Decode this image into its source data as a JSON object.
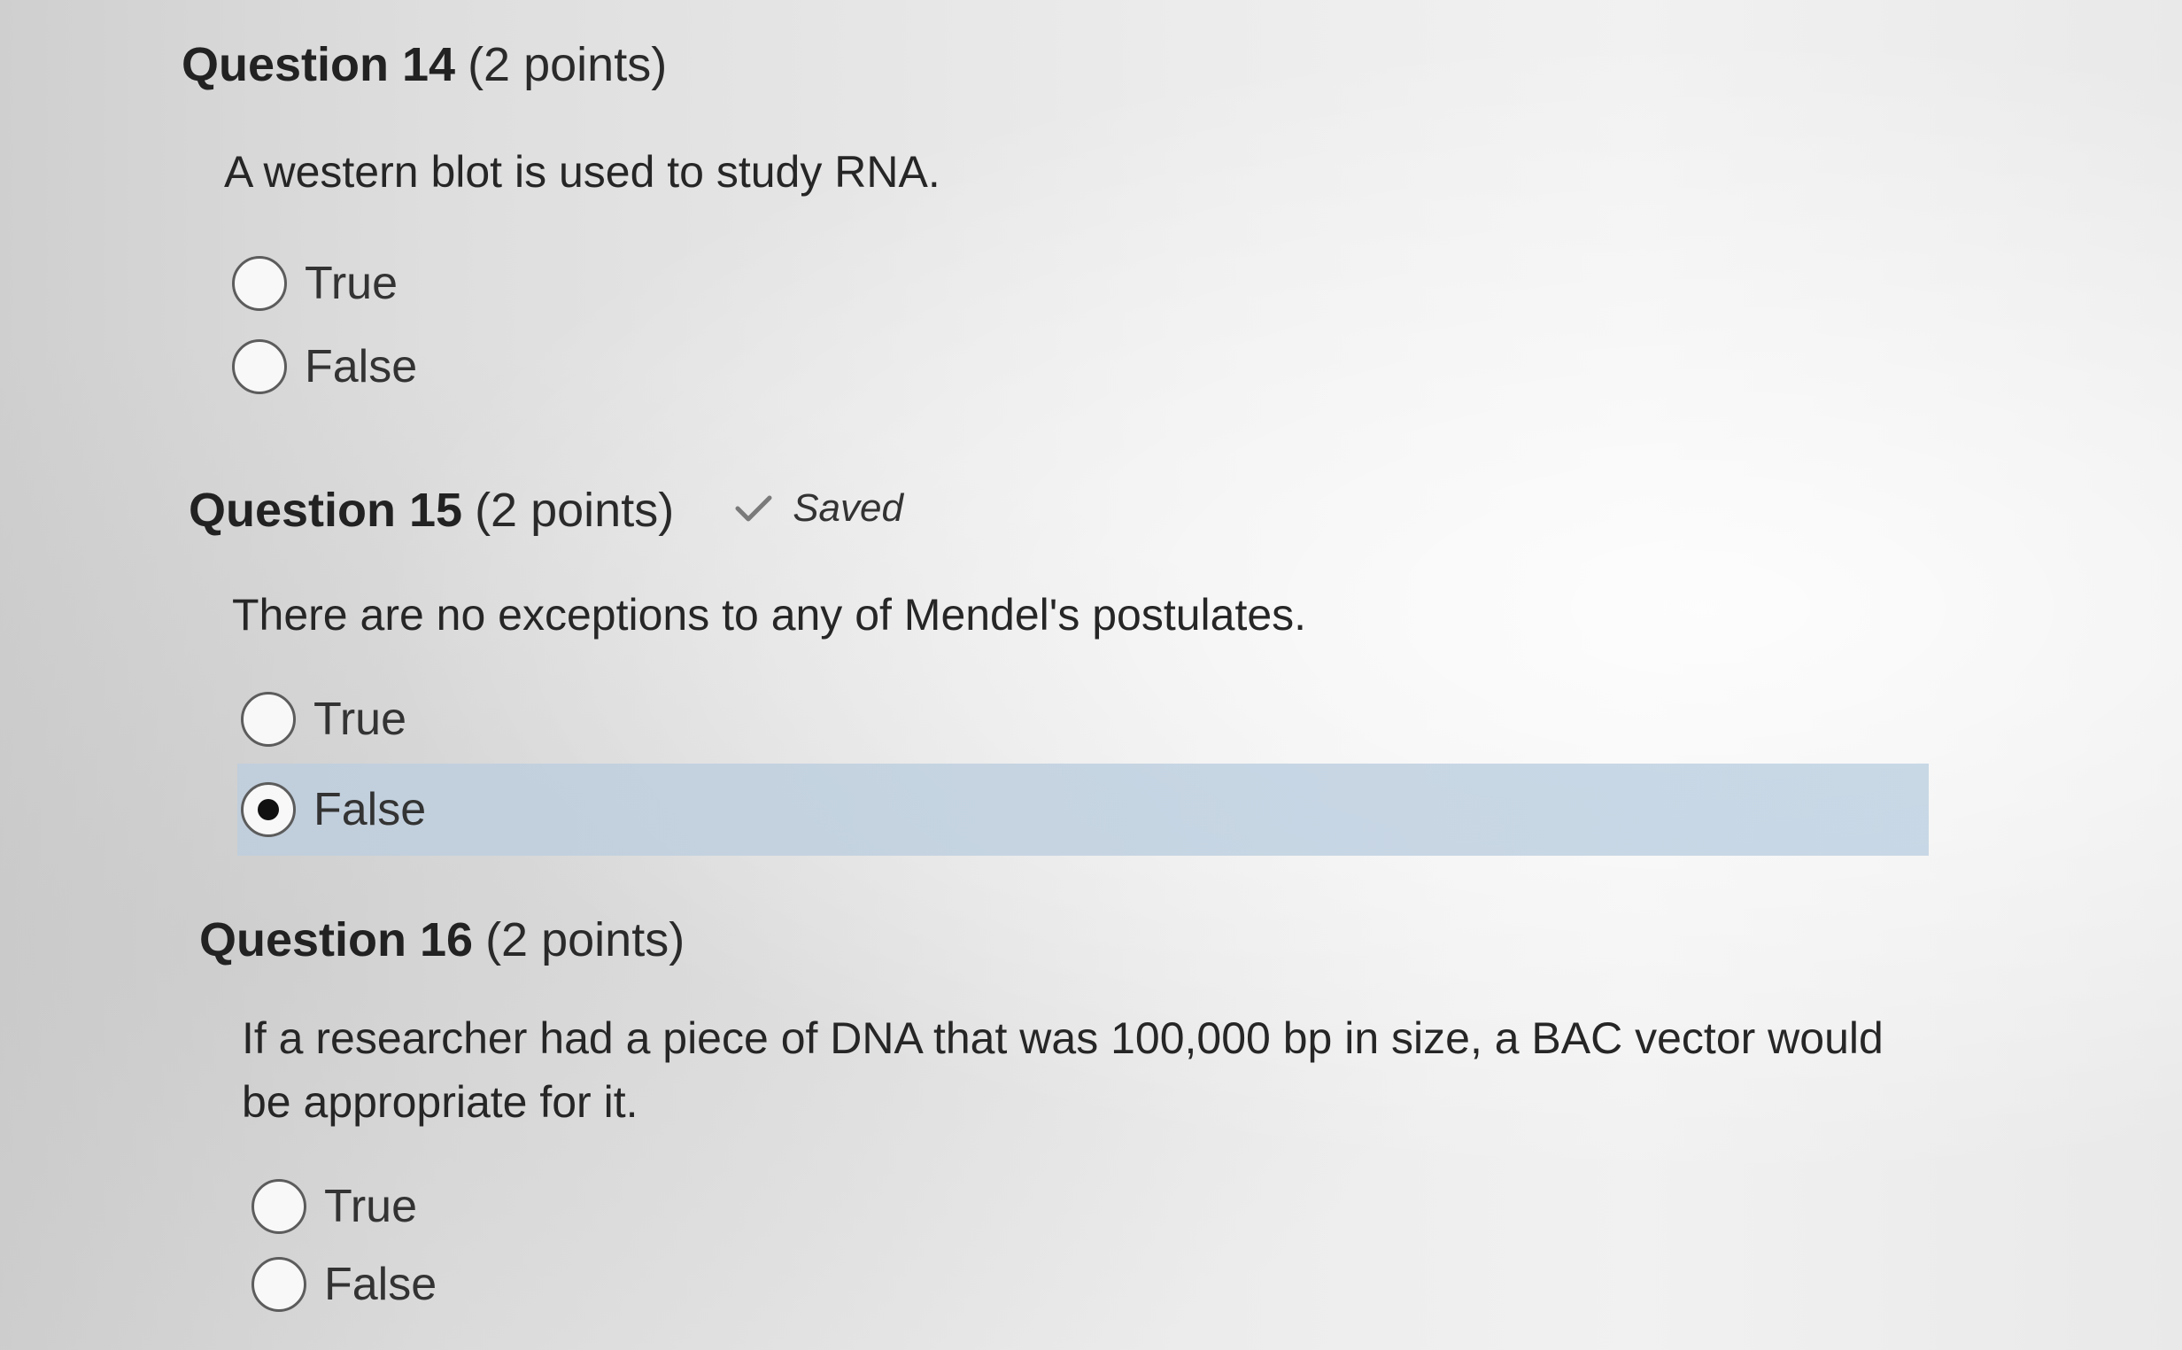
{
  "questions": [
    {
      "title": "Question 14",
      "points": "(2 points)",
      "text": "A western blot is used to study RNA.",
      "options": [
        {
          "label": "True",
          "selected": false
        },
        {
          "label": "False",
          "selected": false
        }
      ]
    },
    {
      "title": "Question 15",
      "points": "(2 points)",
      "status": {
        "icon": "check-icon",
        "label": "Saved"
      },
      "text": "There are no exceptions to any of Mendel's postulates.",
      "options": [
        {
          "label": "True",
          "selected": false
        },
        {
          "label": "False",
          "selected": true
        }
      ]
    },
    {
      "title": "Question 16",
      "points": "(2 points)",
      "text": "If a researcher had a piece of DNA that was 100,000 bp in size, a BAC vector would be appropriate for it.",
      "options": [
        {
          "label": "True",
          "selected": false
        },
        {
          "label": "False",
          "selected": false
        }
      ]
    }
  ],
  "colors": {
    "selected_highlight": "#c3d3e2",
    "radio_border": "#5c5c5c",
    "text": "#2a2a2a"
  }
}
